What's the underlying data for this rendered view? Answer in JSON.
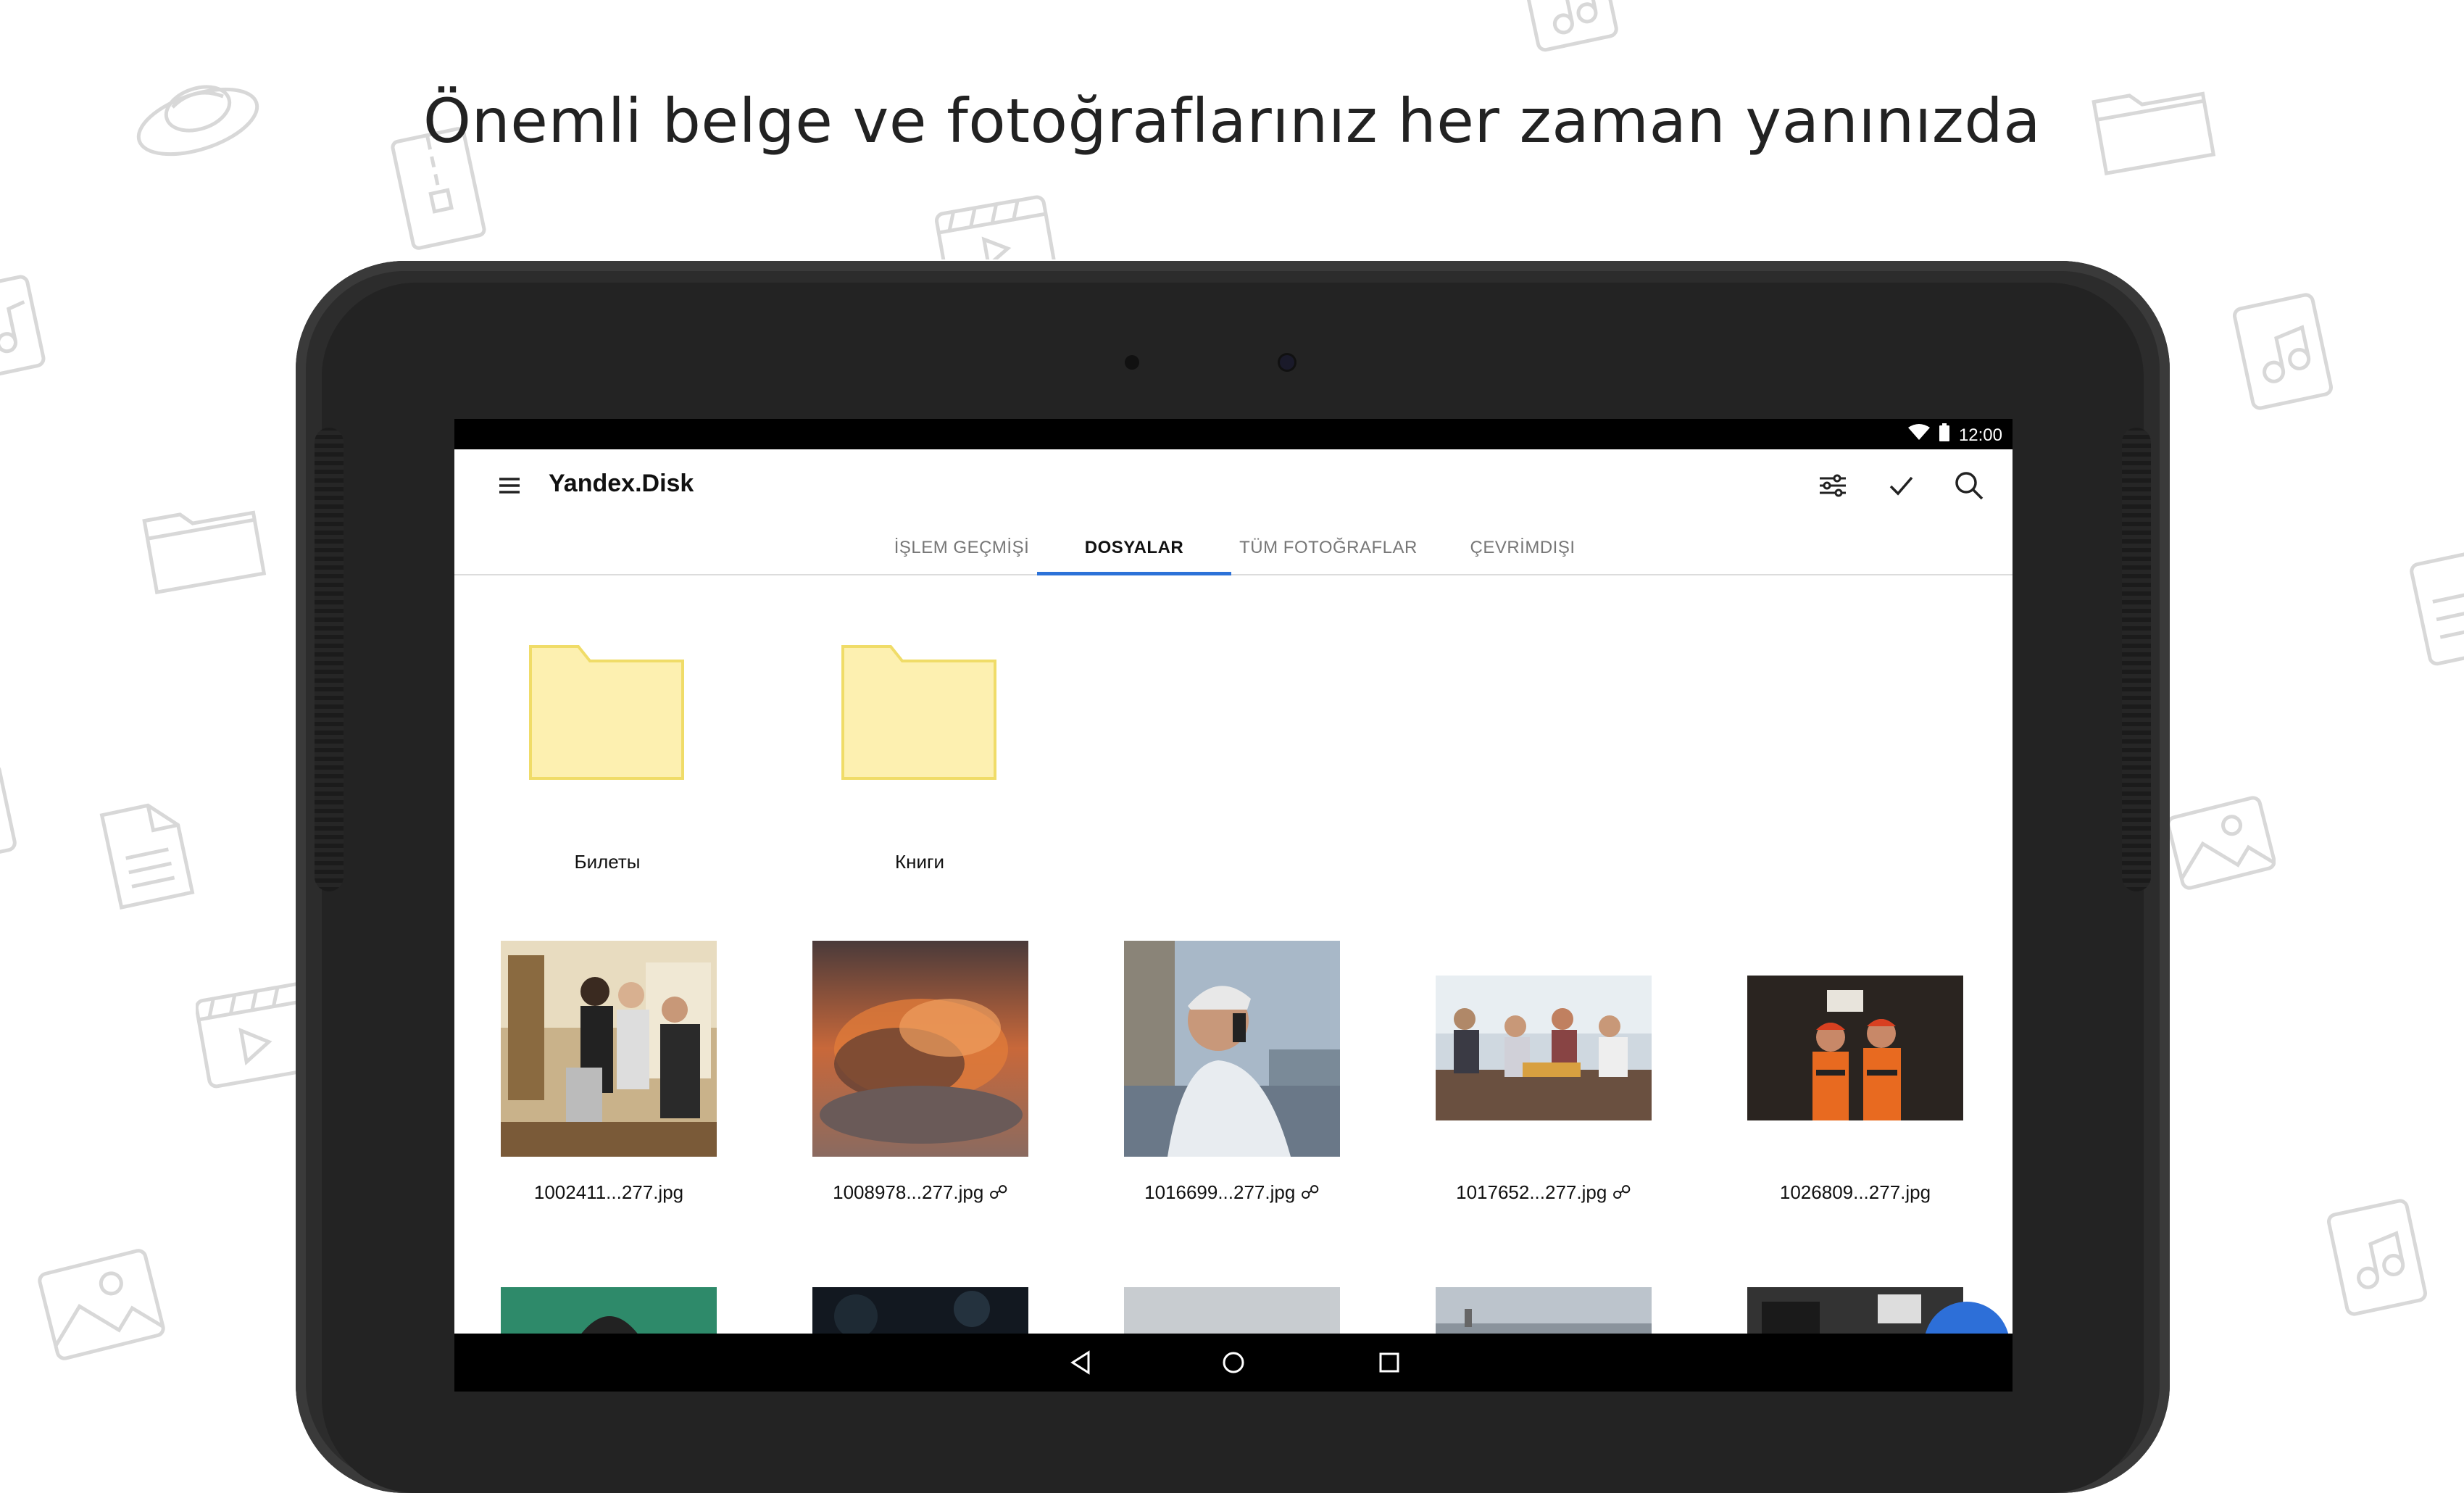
{
  "headline": "Önemli belge ve fotoğraflarınız her zaman yanınızda",
  "status_bar": {
    "time": "12:00",
    "icons": [
      "wifi-icon",
      "battery-icon"
    ]
  },
  "toolbar": {
    "menu_icon": "hamburger-icon",
    "title": "Yandex.Disk",
    "actions": [
      "filter-settings-icon",
      "checkmark-icon",
      "search-icon"
    ]
  },
  "tabs": [
    {
      "label": "İŞLEM GEÇMİŞİ",
      "active": false
    },
    {
      "label": "DOSYALAR",
      "active": true
    },
    {
      "label": "TÜM FOTOĞRAFLAR",
      "active": false
    },
    {
      "label": "ÇEVRİMDIŞI",
      "active": false
    }
  ],
  "folders": [
    {
      "name": "Билеты"
    },
    {
      "name": "Книги"
    }
  ],
  "files": [
    {
      "name": "1002411...277.jpg",
      "shared": false
    },
    {
      "name": "1008978...277.jpg",
      "shared": true
    },
    {
      "name": "1016699...277.jpg",
      "shared": true
    },
    {
      "name": "1017652...277.jpg",
      "shared": true
    },
    {
      "name": "1026809...277.jpg",
      "shared": false
    }
  ],
  "nav_bar": [
    "back-icon",
    "home-icon",
    "recents-icon"
  ],
  "colors": {
    "accent": "#2c72d8",
    "folder_fill": "#fdf0b0",
    "folder_stroke": "#f0dc68"
  }
}
